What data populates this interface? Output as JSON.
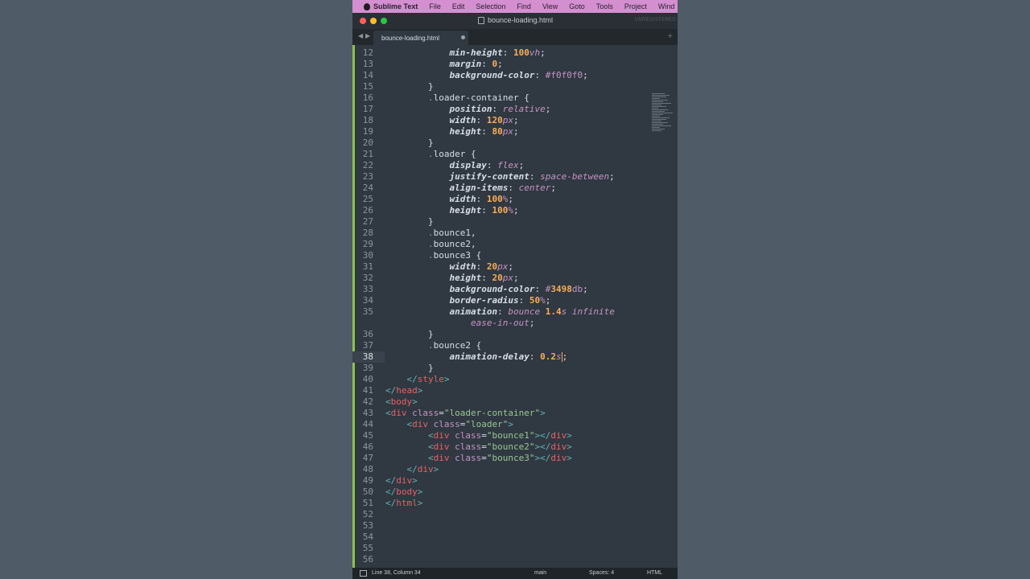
{
  "menubar": {
    "app_name": "Sublime Text",
    "items": [
      "File",
      "Edit",
      "Selection",
      "Find",
      "View",
      "Goto",
      "Tools",
      "Project",
      "Wind"
    ]
  },
  "window": {
    "title": "bounce-loading.html",
    "unregistered": "UNREGISTERED"
  },
  "tab": {
    "label": "bounce-loading.html"
  },
  "editor": {
    "current_line": 38,
    "lines": [
      {
        "n": "12",
        "text": "            min-height: 100vh;"
      },
      {
        "n": "13",
        "text": "            margin: 0;"
      },
      {
        "n": "14",
        "text": "            background-color: #f0f0f0;"
      },
      {
        "n": "15",
        "text": "        }"
      },
      {
        "n": "16",
        "text": "        .loader-container {"
      },
      {
        "n": "17",
        "text": "            position: relative;"
      },
      {
        "n": "18",
        "text": "            width: 120px;"
      },
      {
        "n": "19",
        "text": "            height: 80px;"
      },
      {
        "n": "20",
        "text": "        }"
      },
      {
        "n": "21",
        "text": "        .loader {"
      },
      {
        "n": "22",
        "text": "            display: flex;"
      },
      {
        "n": "23",
        "text": "            justify-content: space-between;"
      },
      {
        "n": "24",
        "text": "            align-items: center;"
      },
      {
        "n": "25",
        "text": "            width: 100%;"
      },
      {
        "n": "26",
        "text": "            height: 100%;"
      },
      {
        "n": "27",
        "text": "        }"
      },
      {
        "n": "28",
        "text": "        .bounce1,"
      },
      {
        "n": "29",
        "text": "        .bounce2,"
      },
      {
        "n": "30",
        "text": "        .bounce3 {"
      },
      {
        "n": "31",
        "text": "            width: 20px;"
      },
      {
        "n": "32",
        "text": "            height: 20px;"
      },
      {
        "n": "33",
        "text": "            background-color: #3498db;"
      },
      {
        "n": "34",
        "text": "            border-radius: 50%;"
      },
      {
        "n": "35",
        "text": "            animation: bounce 1.4s infinite"
      },
      {
        "n": "",
        "text": "                ease-in-out;"
      },
      {
        "n": "36",
        "text": "        }"
      },
      {
        "n": "37",
        "text": "        .bounce2 {"
      },
      {
        "n": "38",
        "text": "            animation-delay: 0.2s;"
      },
      {
        "n": "39",
        "text": "        }"
      },
      {
        "n": "40",
        "text": "    </style>"
      },
      {
        "n": "41",
        "text": "</head>"
      },
      {
        "n": "42",
        "text": "<body>"
      },
      {
        "n": "43",
        "text": "<div class=\"loader-container\">"
      },
      {
        "n": "44",
        "text": "    <div class=\"loader\">"
      },
      {
        "n": "45",
        "text": "        <div class=\"bounce1\"></div>"
      },
      {
        "n": "46",
        "text": "        <div class=\"bounce2\"></div>"
      },
      {
        "n": "47",
        "text": "        <div class=\"bounce3\"></div>"
      },
      {
        "n": "48",
        "text": "    </div>"
      },
      {
        "n": "49",
        "text": "</div>"
      },
      {
        "n": "50",
        "text": "</body>"
      },
      {
        "n": "51",
        "text": "</html>"
      },
      {
        "n": "52",
        "text": ""
      },
      {
        "n": "53",
        "text": ""
      },
      {
        "n": "54",
        "text": ""
      },
      {
        "n": "55",
        "text": ""
      },
      {
        "n": "56",
        "text": ""
      }
    ]
  },
  "statusbar": {
    "position": "Line 38, Column 34",
    "branch": "main",
    "spaces": "Spaces: 4",
    "syntax": "HTML"
  },
  "colors": {
    "background": "#303841",
    "menubar": "#d48fd1",
    "accent_green": "#8bc34a"
  }
}
